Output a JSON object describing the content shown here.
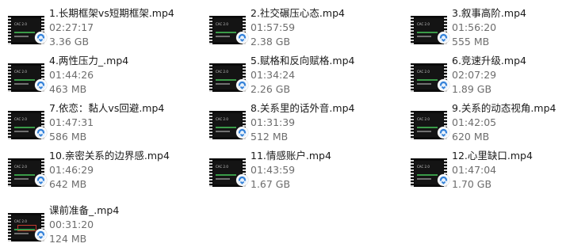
{
  "files": [
    {
      "name": "1.长期框架vs短期框架.mp4",
      "duration": "02:27:17",
      "size": "3.36 GB"
    },
    {
      "name": "2.社交碾压心态.mp4",
      "duration": "01:57:59",
      "size": "2.38 GB"
    },
    {
      "name": "3.叙事高阶.mp4",
      "duration": "01:56:20",
      "size": "555 MB"
    },
    {
      "name": "4.两性压力_.mp4",
      "duration": "01:44:26",
      "size": "463 MB"
    },
    {
      "name": "5.赋格和反向赋格.mp4",
      "duration": "01:34:24",
      "size": "2.26 GB"
    },
    {
      "name": "6.竞速升级.mp4",
      "duration": "02:07:29",
      "size": "1.89 GB"
    },
    {
      "name": "7.依恋：黏人vs回避.mp4",
      "duration": "01:47:31",
      "size": "586 MB"
    },
    {
      "name": "8.关系里的话外音.mp4",
      "duration": "01:31:39",
      "size": "512 MB"
    },
    {
      "name": "9.关系的动态视角.mp4",
      "duration": "01:42:05",
      "size": "620 MB"
    },
    {
      "name": "10.亲密关系的边界感.mp4",
      "duration": "01:46:29",
      "size": "642 MB"
    },
    {
      "name": "11.情感账户.mp4",
      "duration": "01:43:59",
      "size": "1.67 GB"
    },
    {
      "name": "12.心里缺口.mp4",
      "duration": "01:47:04",
      "size": "1.70 GB"
    },
    {
      "name": "课前准备_.mp4",
      "duration": "00:31:20",
      "size": "124 MB"
    }
  ],
  "thumbnail_text": "CAC 2.0",
  "file_icon": "video-file-thumbnail-icon",
  "overlay_icon": "media-player-icon",
  "colors": {
    "name": "#1a1a1a",
    "meta": "#6d6d6d",
    "overlay": "#2f7fd8"
  }
}
